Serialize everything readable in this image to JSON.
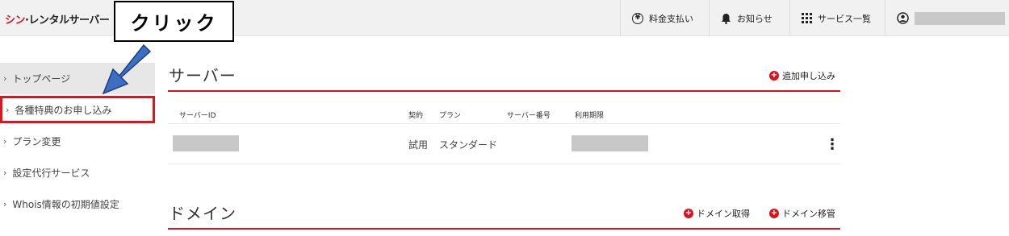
{
  "header": {
    "logo_brand": "シン",
    "logo_rest": "·レンタルサーバー",
    "nav": {
      "payment_icon": "¥",
      "payment_label": "料金支払い",
      "news_label": "お知らせ",
      "services_label": "サービス一覧"
    }
  },
  "callout": {
    "text": "クリック"
  },
  "sidebar": {
    "items": [
      {
        "label": "トップページ"
      },
      {
        "label": "各種特典のお申し込み"
      },
      {
        "label": "プラン変更"
      },
      {
        "label": "設定代行サービス"
      },
      {
        "label": "Whois情報の初期値設定"
      }
    ]
  },
  "server_section": {
    "title": "サーバー",
    "add_link": "追加申し込み",
    "columns": [
      "サーバーID",
      "契約",
      "プラン",
      "サーバー番号",
      "利用期限"
    ],
    "row": {
      "contract": "試用",
      "plan": "スタンダード"
    }
  },
  "domain_section": {
    "title": "ドメイン",
    "acquire_link": "ドメイン取得",
    "transfer_link": "ドメイン移管"
  },
  "colors": {
    "accent": "#d9131e",
    "highlight_box": "#e0141c",
    "arrow": "#3c6fc4"
  },
  "icons": [
    "yen-circle-icon",
    "bell-icon",
    "grid-icon",
    "user-icon",
    "chevron-right-icon",
    "plus-circle-icon",
    "kebab-icon"
  ]
}
